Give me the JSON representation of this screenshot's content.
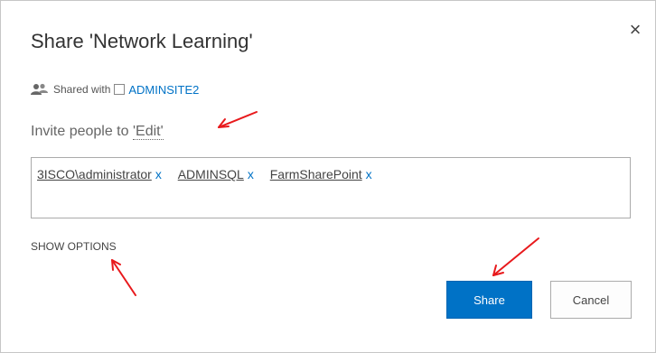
{
  "dialog": {
    "title": "Share 'Network Learning'",
    "close_glyph": "×"
  },
  "shared_with": {
    "label": "Shared with",
    "link": "ADMINSITE2",
    "icon": "people-icon"
  },
  "invite": {
    "prefix": "Invite people to ",
    "permission": "'Edit'"
  },
  "people": [
    {
      "name": "3ISCO\\administrator",
      "remove": "x"
    },
    {
      "name": "ADMINSQL",
      "remove": "x"
    },
    {
      "name": "FarmSharePoint",
      "remove": "x"
    }
  ],
  "options": {
    "show_options": "SHOW OPTIONS"
  },
  "buttons": {
    "share": "Share",
    "cancel": "Cancel"
  },
  "colors": {
    "accent": "#0072c6",
    "annotation_arrow": "#e8191c"
  }
}
